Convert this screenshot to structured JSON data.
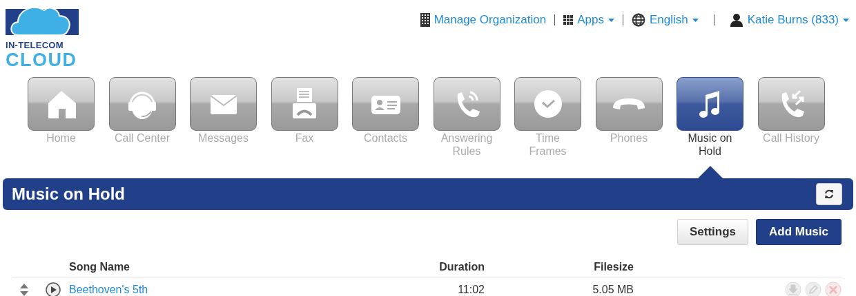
{
  "logo": {
    "line_1": "IN-TELECOM",
    "line_2": "CLOUD"
  },
  "top_links": [
    {
      "label": "Manage Organization",
      "dropdown": false
    },
    {
      "label": "Apps",
      "dropdown": true
    },
    {
      "label": "English",
      "dropdown": true
    },
    {
      "label": "Katie Burns (833)",
      "dropdown": true
    }
  ],
  "nav": [
    {
      "label": "Home",
      "selected": false
    },
    {
      "label": "Call Center",
      "selected": false
    },
    {
      "label": "Messages",
      "selected": false
    },
    {
      "label": "Fax",
      "selected": false
    },
    {
      "label": "Contacts",
      "selected": false
    },
    {
      "label": "Answering Rules",
      "selected": false
    },
    {
      "label": "Time Frames",
      "selected": false
    },
    {
      "label": "Phones",
      "selected": false
    },
    {
      "label": "Music on Hold",
      "selected": true
    },
    {
      "label": "Call History",
      "selected": false
    }
  ],
  "panel": {
    "title": "Music on Hold"
  },
  "buttons": [
    {
      "label": "Settings",
      "kind": "secondary"
    },
    {
      "label": "Add Music",
      "kind": "primary"
    }
  ],
  "table": {
    "columns": [
      "Song Name",
      "Duration",
      "Filesize"
    ],
    "rows": [
      {
        "song_name": "Beethoven's 5th",
        "duration": "11:02",
        "filesize": "5.05 MB",
        "actions_disabled": true
      }
    ]
  }
}
